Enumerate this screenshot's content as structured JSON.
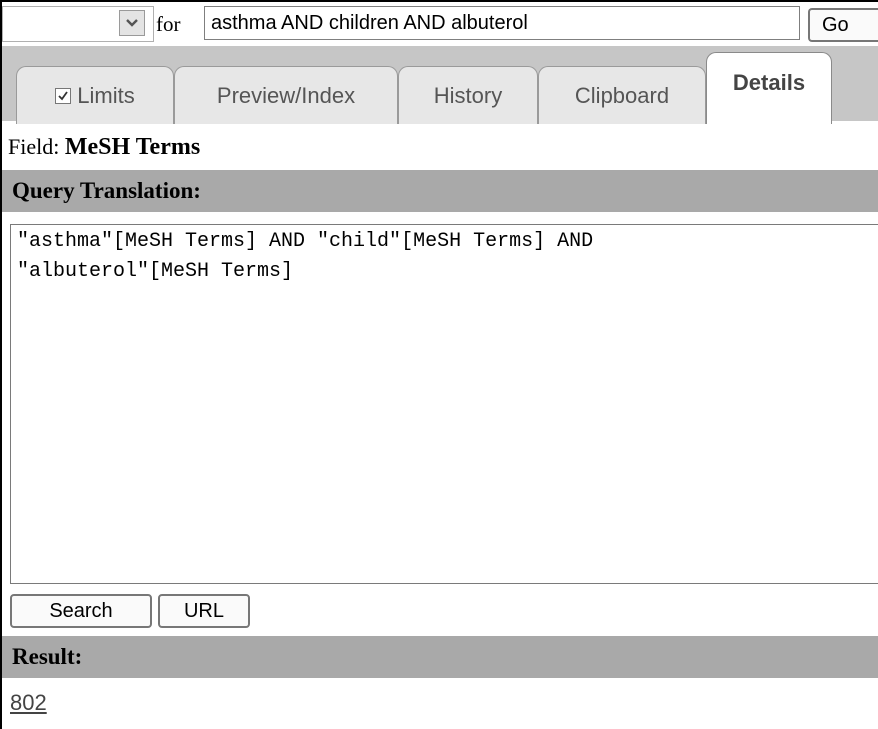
{
  "search": {
    "for_label": "for",
    "query_value": "asthma AND children AND albuterol",
    "go_label": "Go"
  },
  "tabs": [
    {
      "label": "Limits",
      "checked": true
    },
    {
      "label": "Preview/Index"
    },
    {
      "label": "History"
    },
    {
      "label": "Clipboard"
    },
    {
      "label": "Details",
      "active": true
    }
  ],
  "details": {
    "field_label": "Field:",
    "field_value": "MeSH Terms",
    "query_translation_header": "Query Translation:",
    "query_translation_text": "\"asthma\"[MeSH Terms] AND \"child\"[MeSH Terms] AND\n\"albuterol\"[MeSH Terms]",
    "search_button": "Search",
    "url_button": "URL",
    "result_header": "Result:",
    "result_count": "802"
  },
  "colors": {
    "header_bg": "#a9a9a9",
    "tabs_bg": "#c6c6c6",
    "active_tab_bg": "#ffffff"
  },
  "icons": {
    "dropdown": "chevron-down-icon",
    "checkbox": "checkmark-icon"
  }
}
